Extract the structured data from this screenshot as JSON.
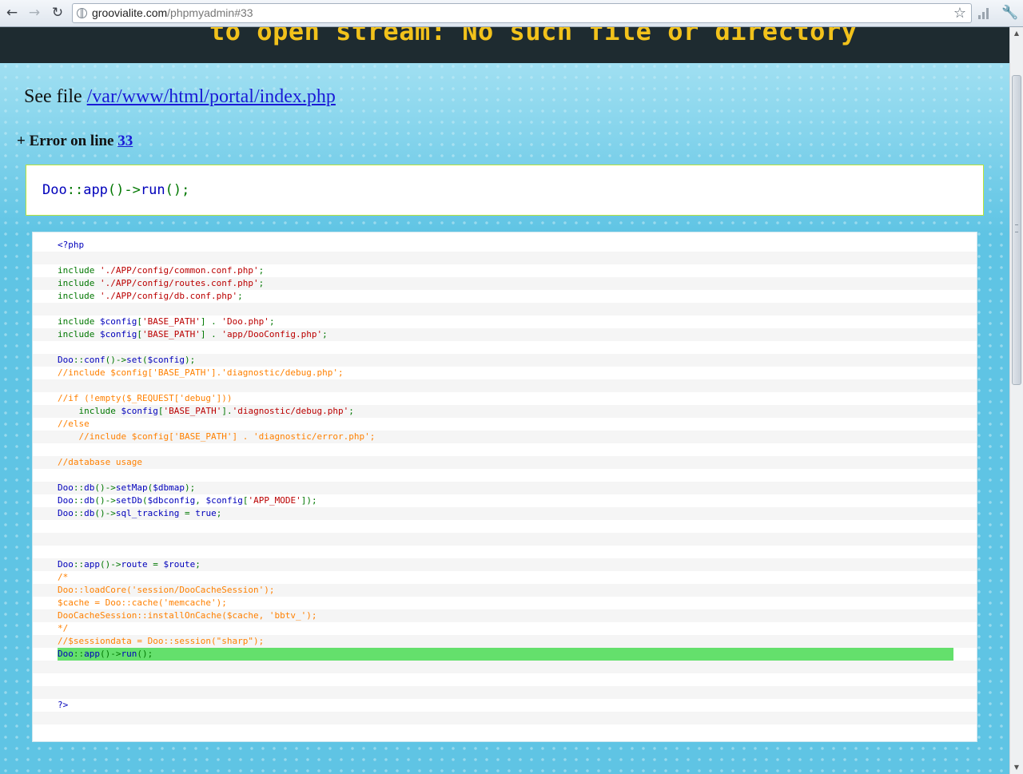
{
  "browser": {
    "url_host": "groovialite.com",
    "url_path": "/phpmyadmin#33",
    "back_icon": "arrow-left",
    "forward_icon": "arrow-right",
    "reload_icon": "reload",
    "star_icon": "star",
    "page_icon": "globe",
    "menu_icon": "wrench"
  },
  "page": {
    "banner_text": "to open stream: No such file or directory",
    "see_file_prefix": "See file ",
    "file_link": "/var/www/html/portal/index.php",
    "error_prefix": "+ Error on line ",
    "error_line": "33",
    "snippet": {
      "cls": "Doo",
      "sep": "::",
      "m1": "app",
      "p1": "()",
      "arrow": "->",
      "m2": "run",
      "p2": "();"
    }
  },
  "code_lines": [
    {
      "segments": [
        [
          "df",
          "<?php"
        ]
      ]
    },
    {
      "segments": []
    },
    {
      "segments": [
        [
          "kw",
          "include "
        ],
        [
          "str",
          "'./APP/config/common.conf.php'"
        ],
        [
          "kw",
          ";"
        ]
      ]
    },
    {
      "segments": [
        [
          "kw",
          "include "
        ],
        [
          "str",
          "'./APP/config/routes.conf.php'"
        ],
        [
          "kw",
          ";"
        ]
      ]
    },
    {
      "segments": [
        [
          "kw",
          "include "
        ],
        [
          "str",
          "'./APP/config/db.conf.php'"
        ],
        [
          "kw",
          ";"
        ]
      ]
    },
    {
      "segments": []
    },
    {
      "segments": [
        [
          "kw",
          "include "
        ],
        [
          "var",
          "$config"
        ],
        [
          "kw",
          "["
        ],
        [
          "str",
          "'BASE_PATH'"
        ],
        [
          "kw",
          "] . "
        ],
        [
          "str",
          "'Doo.php'"
        ],
        [
          "kw",
          ";"
        ]
      ]
    },
    {
      "segments": [
        [
          "kw",
          "include "
        ],
        [
          "var",
          "$config"
        ],
        [
          "kw",
          "["
        ],
        [
          "str",
          "'BASE_PATH'"
        ],
        [
          "kw",
          "] . "
        ],
        [
          "str",
          "'app/DooConfig.php'"
        ],
        [
          "kw",
          ";"
        ]
      ]
    },
    {
      "segments": []
    },
    {
      "segments": [
        [
          "var",
          "Doo"
        ],
        [
          "kw",
          "::"
        ],
        [
          "var",
          "conf"
        ],
        [
          "kw",
          "()->"
        ],
        [
          "var",
          "set"
        ],
        [
          "kw",
          "("
        ],
        [
          "var",
          "$config"
        ],
        [
          "kw",
          ");"
        ]
      ]
    },
    {
      "segments": [
        [
          "cm",
          "//include $config['BASE_PATH'].'diagnostic/debug.php';"
        ]
      ]
    },
    {
      "segments": []
    },
    {
      "segments": [
        [
          "cm",
          "//if (!empty($_REQUEST['debug']))"
        ]
      ]
    },
    {
      "segments": [
        [
          "kw",
          "    include "
        ],
        [
          "var",
          "$config"
        ],
        [
          "kw",
          "["
        ],
        [
          "str",
          "'BASE_PATH'"
        ],
        [
          "kw",
          "]."
        ],
        [
          "str",
          "'diagnostic/debug.php'"
        ],
        [
          "kw",
          ";"
        ]
      ]
    },
    {
      "segments": [
        [
          "cm",
          "//else"
        ]
      ]
    },
    {
      "segments": [
        [
          "cm",
          "    //include $config['BASE_PATH'] . 'diagnostic/error.php';"
        ]
      ]
    },
    {
      "segments": []
    },
    {
      "segments": [
        [
          "cm",
          "//database usage"
        ]
      ]
    },
    {
      "segments": []
    },
    {
      "segments": [
        [
          "var",
          "Doo"
        ],
        [
          "kw",
          "::"
        ],
        [
          "var",
          "db"
        ],
        [
          "kw",
          "()->"
        ],
        [
          "var",
          "setMap"
        ],
        [
          "kw",
          "("
        ],
        [
          "var",
          "$dbmap"
        ],
        [
          "kw",
          ");"
        ]
      ]
    },
    {
      "segments": [
        [
          "var",
          "Doo"
        ],
        [
          "kw",
          "::"
        ],
        [
          "var",
          "db"
        ],
        [
          "kw",
          "()->"
        ],
        [
          "var",
          "setDb"
        ],
        [
          "kw",
          "("
        ],
        [
          "var",
          "$dbconfig"
        ],
        [
          "kw",
          ", "
        ],
        [
          "var",
          "$config"
        ],
        [
          "kw",
          "["
        ],
        [
          "str",
          "'APP_MODE'"
        ],
        [
          "kw",
          "]);"
        ]
      ]
    },
    {
      "segments": [
        [
          "var",
          "Doo"
        ],
        [
          "kw",
          "::"
        ],
        [
          "var",
          "db"
        ],
        [
          "kw",
          "()->"
        ],
        [
          "var",
          "sql_tracking "
        ],
        [
          "kw",
          "= "
        ],
        [
          "var",
          "true"
        ],
        [
          "kw",
          ";"
        ]
      ]
    },
    {
      "segments": []
    },
    {
      "segments": []
    },
    {
      "segments": []
    },
    {
      "segments": [
        [
          "var",
          "Doo"
        ],
        [
          "kw",
          "::"
        ],
        [
          "var",
          "app"
        ],
        [
          "kw",
          "()->"
        ],
        [
          "var",
          "route "
        ],
        [
          "kw",
          "= "
        ],
        [
          "var",
          "$route"
        ],
        [
          "kw",
          ";"
        ]
      ]
    },
    {
      "segments": [
        [
          "cm",
          "/*"
        ]
      ]
    },
    {
      "segments": [
        [
          "cm",
          "Doo::loadCore('session/DooCacheSession');"
        ]
      ]
    },
    {
      "segments": [
        [
          "cm",
          "$cache = Doo::cache('memcache');"
        ]
      ]
    },
    {
      "segments": [
        [
          "cm",
          "DooCacheSession::installOnCache($cache, 'bbtv_');"
        ]
      ]
    },
    {
      "segments": [
        [
          "cm",
          "*/"
        ]
      ]
    },
    {
      "segments": [
        [
          "cm",
          "//$sessiondata = Doo::session(\"sharp\");"
        ]
      ]
    },
    {
      "segments": [
        [
          "var",
          "Doo"
        ],
        [
          "kw",
          "::"
        ],
        [
          "var",
          "app"
        ],
        [
          "kw",
          "()->"
        ],
        [
          "var",
          "run"
        ],
        [
          "kw",
          "();"
        ]
      ],
      "highlight": true
    },
    {
      "segments": []
    },
    {
      "segments": []
    },
    {
      "segments": []
    },
    {
      "segments": [
        [
          "df",
          "?>"
        ]
      ]
    },
    {
      "segments": []
    }
  ]
}
